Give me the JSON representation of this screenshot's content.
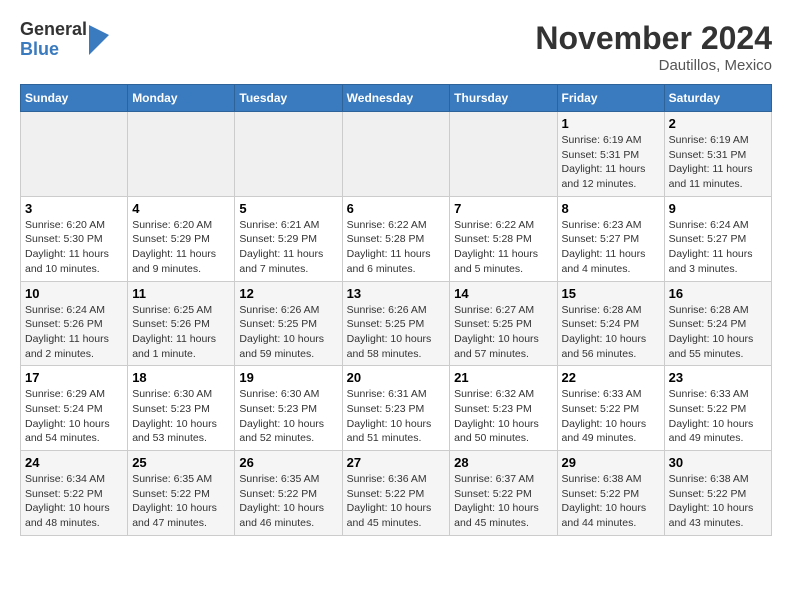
{
  "header": {
    "logo": {
      "general": "General",
      "blue": "Blue"
    },
    "month": "November 2024",
    "location": "Dautillos, Mexico"
  },
  "weekdays": [
    "Sunday",
    "Monday",
    "Tuesday",
    "Wednesday",
    "Thursday",
    "Friday",
    "Saturday"
  ],
  "weeks": [
    [
      {
        "day": "",
        "info": ""
      },
      {
        "day": "",
        "info": ""
      },
      {
        "day": "",
        "info": ""
      },
      {
        "day": "",
        "info": ""
      },
      {
        "day": "",
        "info": ""
      },
      {
        "day": "1",
        "info": "Sunrise: 6:19 AM\nSunset: 5:31 PM\nDaylight: 11 hours and 12 minutes."
      },
      {
        "day": "2",
        "info": "Sunrise: 6:19 AM\nSunset: 5:31 PM\nDaylight: 11 hours and 11 minutes."
      }
    ],
    [
      {
        "day": "3",
        "info": "Sunrise: 6:20 AM\nSunset: 5:30 PM\nDaylight: 11 hours and 10 minutes."
      },
      {
        "day": "4",
        "info": "Sunrise: 6:20 AM\nSunset: 5:29 PM\nDaylight: 11 hours and 9 minutes."
      },
      {
        "day": "5",
        "info": "Sunrise: 6:21 AM\nSunset: 5:29 PM\nDaylight: 11 hours and 7 minutes."
      },
      {
        "day": "6",
        "info": "Sunrise: 6:22 AM\nSunset: 5:28 PM\nDaylight: 11 hours and 6 minutes."
      },
      {
        "day": "7",
        "info": "Sunrise: 6:22 AM\nSunset: 5:28 PM\nDaylight: 11 hours and 5 minutes."
      },
      {
        "day": "8",
        "info": "Sunrise: 6:23 AM\nSunset: 5:27 PM\nDaylight: 11 hours and 4 minutes."
      },
      {
        "day": "9",
        "info": "Sunrise: 6:24 AM\nSunset: 5:27 PM\nDaylight: 11 hours and 3 minutes."
      }
    ],
    [
      {
        "day": "10",
        "info": "Sunrise: 6:24 AM\nSunset: 5:26 PM\nDaylight: 11 hours and 2 minutes."
      },
      {
        "day": "11",
        "info": "Sunrise: 6:25 AM\nSunset: 5:26 PM\nDaylight: 11 hours and 1 minute."
      },
      {
        "day": "12",
        "info": "Sunrise: 6:26 AM\nSunset: 5:25 PM\nDaylight: 10 hours and 59 minutes."
      },
      {
        "day": "13",
        "info": "Sunrise: 6:26 AM\nSunset: 5:25 PM\nDaylight: 10 hours and 58 minutes."
      },
      {
        "day": "14",
        "info": "Sunrise: 6:27 AM\nSunset: 5:25 PM\nDaylight: 10 hours and 57 minutes."
      },
      {
        "day": "15",
        "info": "Sunrise: 6:28 AM\nSunset: 5:24 PM\nDaylight: 10 hours and 56 minutes."
      },
      {
        "day": "16",
        "info": "Sunrise: 6:28 AM\nSunset: 5:24 PM\nDaylight: 10 hours and 55 minutes."
      }
    ],
    [
      {
        "day": "17",
        "info": "Sunrise: 6:29 AM\nSunset: 5:24 PM\nDaylight: 10 hours and 54 minutes."
      },
      {
        "day": "18",
        "info": "Sunrise: 6:30 AM\nSunset: 5:23 PM\nDaylight: 10 hours and 53 minutes."
      },
      {
        "day": "19",
        "info": "Sunrise: 6:30 AM\nSunset: 5:23 PM\nDaylight: 10 hours and 52 minutes."
      },
      {
        "day": "20",
        "info": "Sunrise: 6:31 AM\nSunset: 5:23 PM\nDaylight: 10 hours and 51 minutes."
      },
      {
        "day": "21",
        "info": "Sunrise: 6:32 AM\nSunset: 5:23 PM\nDaylight: 10 hours and 50 minutes."
      },
      {
        "day": "22",
        "info": "Sunrise: 6:33 AM\nSunset: 5:22 PM\nDaylight: 10 hours and 49 minutes."
      },
      {
        "day": "23",
        "info": "Sunrise: 6:33 AM\nSunset: 5:22 PM\nDaylight: 10 hours and 49 minutes."
      }
    ],
    [
      {
        "day": "24",
        "info": "Sunrise: 6:34 AM\nSunset: 5:22 PM\nDaylight: 10 hours and 48 minutes."
      },
      {
        "day": "25",
        "info": "Sunrise: 6:35 AM\nSunset: 5:22 PM\nDaylight: 10 hours and 47 minutes."
      },
      {
        "day": "26",
        "info": "Sunrise: 6:35 AM\nSunset: 5:22 PM\nDaylight: 10 hours and 46 minutes."
      },
      {
        "day": "27",
        "info": "Sunrise: 6:36 AM\nSunset: 5:22 PM\nDaylight: 10 hours and 45 minutes."
      },
      {
        "day": "28",
        "info": "Sunrise: 6:37 AM\nSunset: 5:22 PM\nDaylight: 10 hours and 45 minutes."
      },
      {
        "day": "29",
        "info": "Sunrise: 6:38 AM\nSunset: 5:22 PM\nDaylight: 10 hours and 44 minutes."
      },
      {
        "day": "30",
        "info": "Sunrise: 6:38 AM\nSunset: 5:22 PM\nDaylight: 10 hours and 43 minutes."
      }
    ]
  ]
}
